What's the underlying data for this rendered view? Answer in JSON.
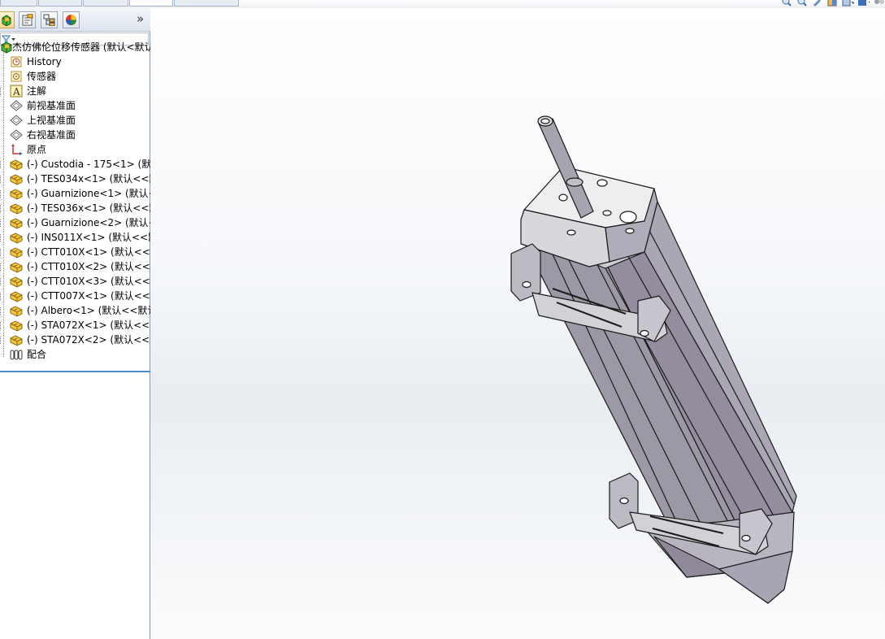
{
  "feature_tree": {
    "root_label": "杰仿佛伦位移传感器 (默认<默认",
    "items": [
      {
        "label": "History",
        "icon": "history-icon"
      },
      {
        "label": "传感器",
        "icon": "sensor-icon"
      },
      {
        "label": "注解",
        "icon": "annotations-icon"
      },
      {
        "label": "前视基准面",
        "icon": "plane-icon"
      },
      {
        "label": "上视基准面",
        "icon": "plane-icon"
      },
      {
        "label": "右视基准面",
        "icon": "plane-icon"
      },
      {
        "label": "原点",
        "icon": "origin-icon"
      },
      {
        "label": "(-) Custodia - 175<1> (默认",
        "icon": "part-icon"
      },
      {
        "label": "(-) TES034x<1> (默认<<默",
        "icon": "part-icon"
      },
      {
        "label": "(-) Guarnizione<1> (默认<",
        "icon": "part-icon"
      },
      {
        "label": "(-) TES036x<1> (默认<<默",
        "icon": "part-icon"
      },
      {
        "label": "(-) Guarnizione<2> (默认<",
        "icon": "part-icon"
      },
      {
        "label": "(-) INS011X<1> (默认<<默",
        "icon": "part-icon"
      },
      {
        "label": "(-) CTT010X<1> (默认<<默",
        "icon": "part-icon"
      },
      {
        "label": "(-) CTT010X<2> (默认<<默",
        "icon": "part-icon"
      },
      {
        "label": "(-) CTT010X<3> (默认<<默",
        "icon": "part-icon"
      },
      {
        "label": "(-) CTT007X<1> (默认<<默",
        "icon": "part-icon"
      },
      {
        "label": "(-) Albero<1> (默认<<默认",
        "icon": "part-icon"
      },
      {
        "label": "(-) STA072X<1> (默认<<默",
        "icon": "part-icon"
      },
      {
        "label": "(-) STA072X<2> (默认<<默",
        "icon": "part-icon"
      },
      {
        "label": "配合",
        "icon": "mates-icon"
      }
    ]
  },
  "panel_tabs": [
    "feature-manager-icon",
    "property-manager-icon",
    "configuration-manager-icon",
    "appearance-manager-icon"
  ],
  "panel_expand_glyph": "»",
  "colors": {
    "model_face_light": "#e6e6e8",
    "model_face_mid": "#aba6b4",
    "model_face_dark": "#938d9e",
    "edge": "#1a1a1a",
    "panel_border": "#8c98a8"
  }
}
